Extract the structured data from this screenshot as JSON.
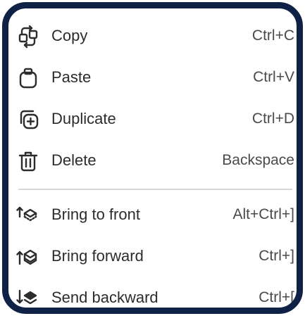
{
  "menu": {
    "items": [
      {
        "icon": "copy-icon",
        "label": "Copy",
        "shortcut": "Ctrl+C"
      },
      {
        "icon": "paste-icon",
        "label": "Paste",
        "shortcut": "Ctrl+V"
      },
      {
        "icon": "duplicate-icon",
        "label": "Duplicate",
        "shortcut": "Ctrl+D"
      },
      {
        "icon": "trash-icon",
        "label": "Delete",
        "shortcut": "Backspace"
      },
      {
        "icon": "bring-to-front-icon",
        "label": "Bring to front",
        "shortcut": "Alt+Ctrl+]"
      },
      {
        "icon": "bring-forward-icon",
        "label": "Bring forward",
        "shortcut": "Ctrl+]"
      },
      {
        "icon": "send-backward-icon",
        "label": "Send backward",
        "shortcut": "Ctrl+["
      }
    ]
  },
  "colors": {
    "frame_border": "#0f2144",
    "text": "#2c2c2c",
    "shortcut_text": "#4a4a4a",
    "divider": "#d8d8d8"
  }
}
